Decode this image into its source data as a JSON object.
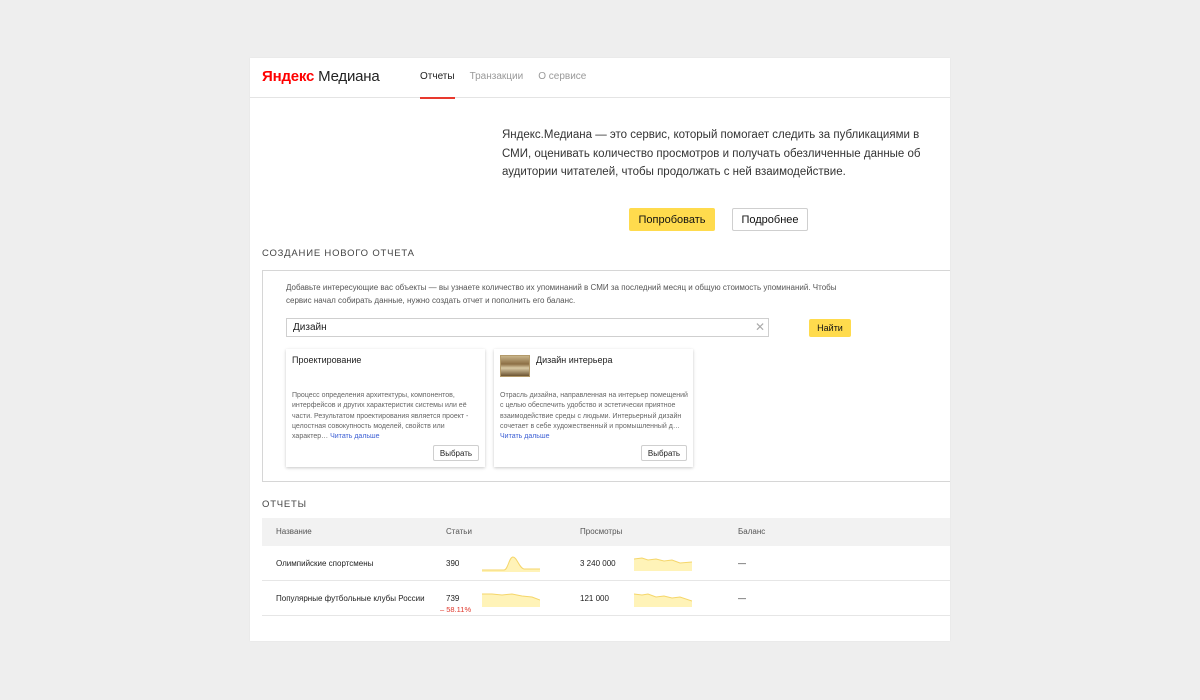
{
  "header": {
    "logo_brand": "Яндекс",
    "logo_product": "Медиана",
    "tabs": [
      {
        "label": "Отчеты",
        "active": true
      },
      {
        "label": "Транзакции",
        "active": false
      },
      {
        "label": "О сервисе",
        "active": false
      }
    ]
  },
  "intro": {
    "text": "Яндекс.Медиана — это сервис, который помогает следить за публикациями в СМИ, оценивать количество просмотров и получать обезличенные данные об аудитории читателей, чтобы продолжать с ней взаимодействие.",
    "try_button": "Попробовать",
    "more_button": "Подробнее"
  },
  "create": {
    "title": "Создание нового отчета",
    "description": "Добавьте интересующие вас объекты — вы узнаете количество их упоминаний в СМИ за последний месяц и общую стоимость упоминаний. Чтобы сервис начал собирать данные, нужно создать отчет и пополнить его баланс.",
    "search_value": "Дизайн",
    "find_button": "Найти",
    "cards": [
      {
        "title": "Проектирование",
        "description": "Процесс определения архитектуры, компонентов, интерфейсов и других характеристик системы или её части. Результатом проектирования является проект - целостная совокупность моделей, свойств или характер…",
        "read_more": "Читать дальше",
        "select": "Выбрать"
      },
      {
        "title": "Дизайн интерьера",
        "description": "Отрасль дизайна, направленная на интерьер помещений с целью обеспечить удобство и эстетически приятное взаимодействие среды с людьми. Интерьерный дизайн сочетает в себе художественный и промышленный д…",
        "read_more": "Читать дальше",
        "select": "Выбрать"
      }
    ]
  },
  "reports": {
    "title": "Отчеты",
    "columns": [
      "Название",
      "Статьи",
      "Просмотры",
      "Баланс"
    ],
    "rows": [
      {
        "name": "Олимпийские спортсмены",
        "articles": "390",
        "articles_delta": "",
        "views": "3 240 000",
        "balance": "—"
      },
      {
        "name": "Популярные футбольные клубы России",
        "articles": "739",
        "articles_delta": "– 58.11%",
        "views": "121 000",
        "balance": "—"
      }
    ],
    "colors": {
      "spark_fill": "#fff3b8",
      "spark_line": "#f5d66a",
      "accent_red": "#e8392e"
    }
  }
}
